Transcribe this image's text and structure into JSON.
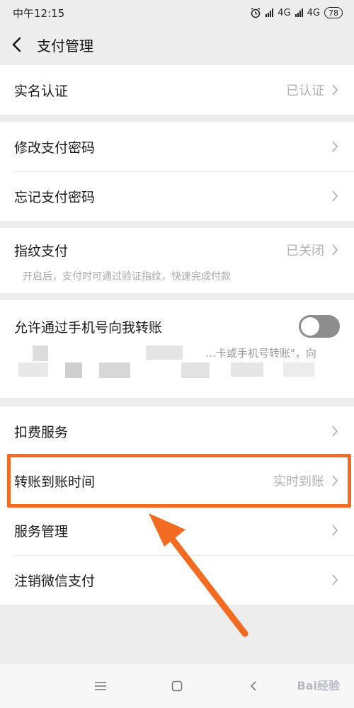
{
  "status_bar": {
    "time": "中午12:15",
    "network_1": "4G",
    "network_2": "4G",
    "battery": "78"
  },
  "header": {
    "title": "支付管理"
  },
  "group_identity": {
    "items": [
      {
        "label": "实名认证",
        "value": "已认证"
      }
    ]
  },
  "group_password": {
    "items": [
      {
        "label": "修改支付密码"
      },
      {
        "label": "忘记支付密码"
      }
    ]
  },
  "group_fingerprint": {
    "label": "指纹支付",
    "value": "已关闭",
    "hint": "开启后，支付时可通过验证指纹，快速完成付款"
  },
  "group_transfer_phone": {
    "label": "允许通过手机号向我转账",
    "toggle_on": false,
    "partial_text": "…卡或手机号转账\"，向"
  },
  "group_services": {
    "items": [
      {
        "label": "扣费服务"
      },
      {
        "label": "转账到账时间",
        "value": "实时到账"
      },
      {
        "label": "服务管理"
      },
      {
        "label": "注销微信支付"
      }
    ]
  },
  "watermark": "Bai经验",
  "colors": {
    "highlight": "#f26b21",
    "toggle_off": "#8d8d8d",
    "background": "#ededed"
  }
}
